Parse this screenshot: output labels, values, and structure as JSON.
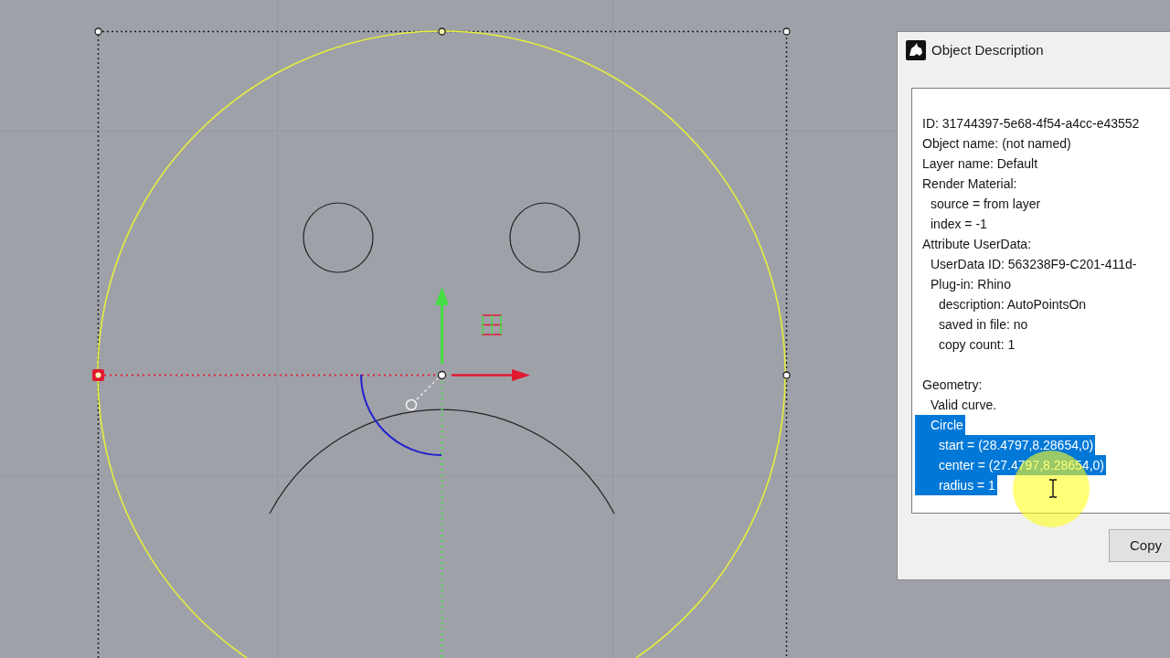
{
  "dialog": {
    "title": "Object Description",
    "sections": [
      {
        "lines": [
          {
            "text": "ID: 31744397-5e68-4f54-a4cc-e43552",
            "selected": false
          },
          {
            "text": "Object name: (not named)",
            "selected": false
          },
          {
            "text": "Layer name: Default",
            "selected": false
          },
          {
            "text": "Render Material:",
            "selected": false,
            "children": [
              {
                "text": "source = from layer",
                "selected": false
              },
              {
                "text": "index = -1",
                "selected": false
              }
            ]
          },
          {
            "text": "Attribute UserData:",
            "selected": false,
            "children": [
              {
                "text": "UserData ID: 563238F9-C201-411d-",
                "selected": false
              },
              {
                "text": "Plug-in: Rhino",
                "selected": false,
                "children": [
                  {
                    "text": "description: AutoPointsOn",
                    "selected": false
                  },
                  {
                    "text": "saved in file: no",
                    "selected": false
                  },
                  {
                    "text": "copy count: 1",
                    "selected": false
                  }
                ]
              }
            ]
          }
        ]
      },
      {
        "lines": [
          {
            "text": "Geometry:",
            "selected": false,
            "children": [
              {
                "text": "Valid curve.",
                "selected": false
              },
              {
                "text": "Circle",
                "selected": true,
                "children": [
                  {
                    "text": "start = (28.4797,8.28654,0)",
                    "selected": true
                  },
                  {
                    "text": "center = (27.4797,8.28654,0)",
                    "selected": true
                  },
                  {
                    "text": "radius = 1",
                    "selected": true
                  }
                ]
              }
            ]
          }
        ]
      }
    ],
    "buttons": [
      "Copy"
    ]
  }
}
